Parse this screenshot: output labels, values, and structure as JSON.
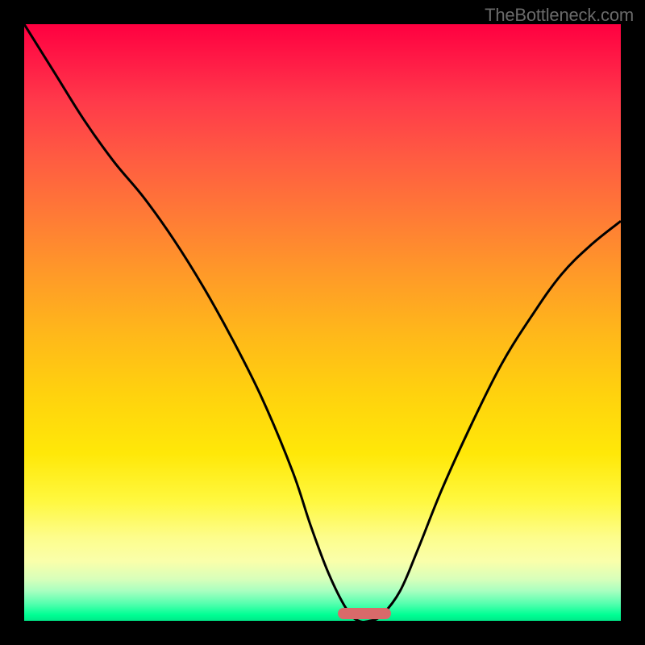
{
  "watermark": "TheBottleneck.com",
  "chart_data": {
    "type": "line",
    "title": "",
    "xlabel": "",
    "ylabel": "",
    "xlim": [
      0,
      100
    ],
    "ylim": [
      0,
      100
    ],
    "legend": false,
    "grid": false,
    "series": [
      {
        "name": "curve",
        "x": [
          0,
          5,
          10,
          15,
          20,
          25,
          30,
          35,
          40,
          45,
          48,
          51,
          54,
          56,
          58,
          60,
          63,
          66,
          70,
          75,
          80,
          85,
          90,
          95,
          100
        ],
        "y": [
          100,
          92,
          84,
          77,
          71,
          64,
          56,
          47,
          37,
          25,
          16,
          8,
          2,
          0,
          0,
          1,
          5,
          12,
          22,
          33,
          43,
          51,
          58,
          63,
          67
        ]
      }
    ],
    "marker": {
      "x_center": 57,
      "width_pct": 9,
      "y": 0.5,
      "color": "#d96a6a"
    },
    "gradient_colors": {
      "top": "#ff0040",
      "mid_upper": "#ff9a28",
      "mid": "#ffe808",
      "mid_lower": "#fdfd8c",
      "bottom": "#00ff94"
    }
  }
}
